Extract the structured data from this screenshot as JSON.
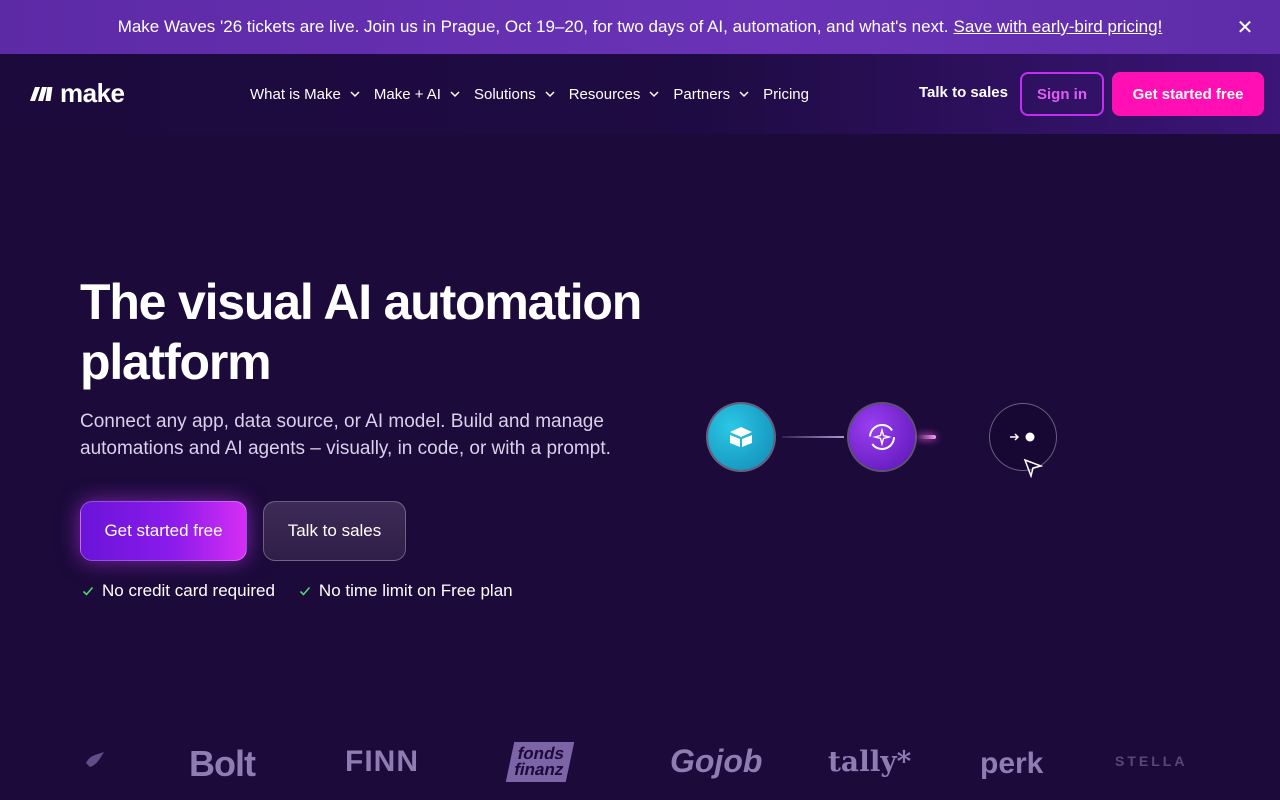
{
  "announcement": {
    "text": "Make Waves '26 tickets are live. Join us in Prague, Oct 19–20, for two days of AI, automation, and what's next.",
    "link": "Save with early-bird pricing!",
    "close_icon": "close-icon"
  },
  "header": {
    "logo_text": "make",
    "nav": [
      {
        "label": "What is Make",
        "has_dropdown": true
      },
      {
        "label": "Make + AI",
        "has_dropdown": true
      },
      {
        "label": "Solutions",
        "has_dropdown": true
      },
      {
        "label": "Resources",
        "has_dropdown": true
      },
      {
        "label": "Partners",
        "has_dropdown": true
      },
      {
        "label": "Pricing",
        "has_dropdown": false
      }
    ],
    "talk_to_sales": "Talk to sales",
    "sign_in": "Sign in",
    "get_started": "Get started free"
  },
  "hero": {
    "title_line1": "The visual AI automation",
    "title_line2": "platform",
    "subtitle": "Connect any app, data source, or AI model. Build and manage automations and AI agents – visually, in code, or with a prompt.",
    "primary_cta": "Get started free",
    "secondary_cta": "Talk to sales",
    "checks": [
      "No credit card required",
      "No time limit on Free plan"
    ]
  },
  "brands": [
    "Bolt",
    "FINN",
    "fonds finanz",
    "Gojob",
    "tally*",
    "perk",
    "STELLA"
  ],
  "colors": {
    "background": "#1b0a3a",
    "announcement": "#5d2aa6",
    "accent_pink": "#ff0fb4",
    "signin_border": "#c42ef0",
    "check_green": "#4fd66f"
  }
}
